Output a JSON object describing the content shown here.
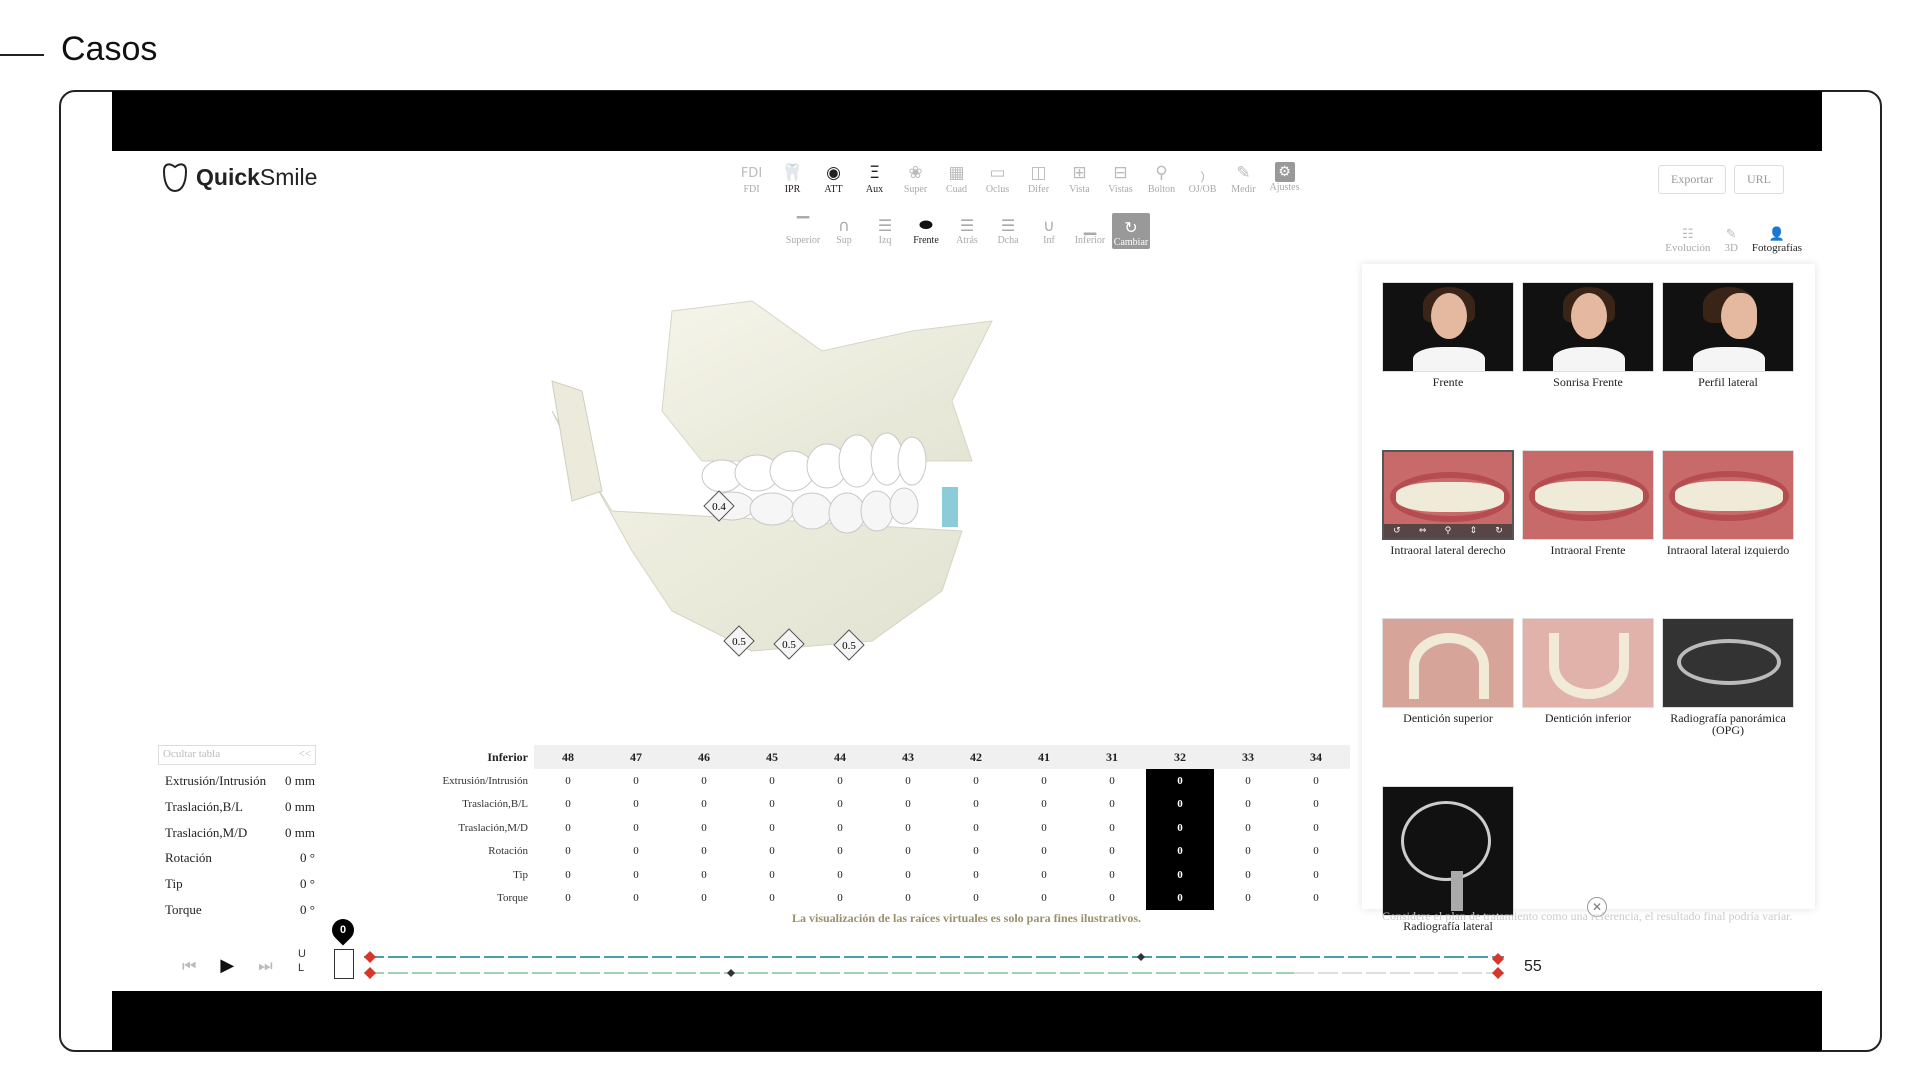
{
  "page": {
    "heading": "Casos"
  },
  "app": {
    "logo": {
      "bold": "Quick",
      "light": "Smile"
    },
    "toolbar": [
      {
        "label": "FDI",
        "icon": "FDI"
      },
      {
        "label": "IPR",
        "icon": "tooth-icon",
        "active": true
      },
      {
        "label": "ATT",
        "icon": "attachment-icon",
        "active": true
      },
      {
        "label": "Aux",
        "icon": "auxiliary-icon",
        "active": true
      },
      {
        "label": "Super",
        "icon": "superimpose-icon"
      },
      {
        "label": "Cuad",
        "icon": "grid-icon"
      },
      {
        "label": "Oclus",
        "icon": "occlusion-icon"
      },
      {
        "label": "Difer",
        "icon": "difference-icon"
      },
      {
        "label": "Vista",
        "icon": "view-icon"
      },
      {
        "label": "Vistas",
        "icon": "views-icon"
      },
      {
        "label": "Bolton",
        "icon": "bolton-icon"
      },
      {
        "label": "OJ/OB",
        "icon": "overjet-icon"
      },
      {
        "label": "Medir",
        "icon": "ruler-icon"
      },
      {
        "label": "Ajustes",
        "icon": "gear-icon"
      }
    ],
    "views": [
      {
        "label": "Superior"
      },
      {
        "label": "Sup"
      },
      {
        "label": "Izq"
      },
      {
        "label": "Frente",
        "active": true
      },
      {
        "label": "Atrás"
      },
      {
        "label": "Dcha"
      },
      {
        "label": "Inf"
      },
      {
        "label": "Inferior"
      },
      {
        "label": "Cambiar",
        "swap": true
      }
    ],
    "top_buttons": {
      "export": "Exportar",
      "url": "URL"
    },
    "panel_tabs": [
      {
        "label": "Evolución"
      },
      {
        "label": "3D"
      },
      {
        "label": "Fotografías",
        "active": true
      }
    ],
    "ipr_labels": [
      "0.4",
      "0.5",
      "0.5",
      "0.5"
    ],
    "photos": [
      {
        "caption": "Frente",
        "kind": "face"
      },
      {
        "caption": "Sonrisa Frente",
        "kind": "face"
      },
      {
        "caption": "Perfil lateral",
        "kind": "profile"
      },
      {
        "caption": "Intraoral lateral derecho",
        "kind": "mouth",
        "selected": true
      },
      {
        "caption": "Intraoral Frente",
        "kind": "mouth"
      },
      {
        "caption": "Intraoral lateral izquierdo",
        "kind": "mouth"
      },
      {
        "caption": "Dentición superior",
        "kind": "occl"
      },
      {
        "caption": "Dentición inferior",
        "kind": "occl-lower"
      },
      {
        "caption": "Radiografía panorámica (OPG)",
        "kind": "pano"
      },
      {
        "caption": "Radiografía lateral",
        "kind": "ceph"
      }
    ],
    "photo_disclaimer": "Considere el plan de tratamiento como una referencia, el resultado final podría variar.",
    "hide_table": {
      "label": "Ocultar tabla",
      "toggle": "<<"
    },
    "left_table": [
      {
        "label": "Extrusión/Intrusión",
        "value": "0 mm"
      },
      {
        "label": "Traslación,B/L",
        "value": "0 mm"
      },
      {
        "label": "Traslación,M/D",
        "value": "0 mm"
      },
      {
        "label": "Rotación",
        "value": "0 °"
      },
      {
        "label": "Tip",
        "value": "0 °"
      },
      {
        "label": "Torque",
        "value": "0 °"
      }
    ],
    "tooth_table": {
      "title": "Inferior",
      "teeth": [
        "48",
        "47",
        "46",
        "45",
        "44",
        "43",
        "42",
        "41",
        "31",
        "32",
        "33",
        "34"
      ],
      "selected_tooth": "32",
      "rows": [
        {
          "label": "Extrusión/Intrusión",
          "values": [
            "0",
            "0",
            "0",
            "0",
            "0",
            "0",
            "0",
            "0",
            "0",
            "0",
            "0",
            "0"
          ]
        },
        {
          "label": "Traslación,B/L",
          "values": [
            "0",
            "0",
            "0",
            "0",
            "0",
            "0",
            "0",
            "0",
            "0",
            "0",
            "0",
            "0"
          ]
        },
        {
          "label": "Traslación,M/D",
          "values": [
            "0",
            "0",
            "0",
            "0",
            "0",
            "0",
            "0",
            "0",
            "0",
            "0",
            "0",
            "0"
          ]
        },
        {
          "label": "Rotación",
          "values": [
            "0",
            "0",
            "0",
            "0",
            "0",
            "0",
            "0",
            "0",
            "0",
            "0",
            "0",
            "0"
          ]
        },
        {
          "label": "Tip",
          "values": [
            "0",
            "0",
            "0",
            "0",
            "0",
            "0",
            "0",
            "0",
            "0",
            "0",
            "0",
            "0"
          ]
        },
        {
          "label": "Torque",
          "values": [
            "0",
            "0",
            "0",
            "0",
            "0",
            "0",
            "0",
            "0",
            "0",
            "0",
            "0",
            "0"
          ]
        }
      ]
    },
    "roots_disclaimer": "La visualización de las raíces virtuales es solo para fines ilustrativos.",
    "player": {
      "stage": "0",
      "upper": "U",
      "lower": "L",
      "total": "55"
    },
    "colors": {
      "upper_track": "#4a9fa8",
      "lower_track": "#9fd3b0",
      "marker": "#d9352b"
    }
  }
}
